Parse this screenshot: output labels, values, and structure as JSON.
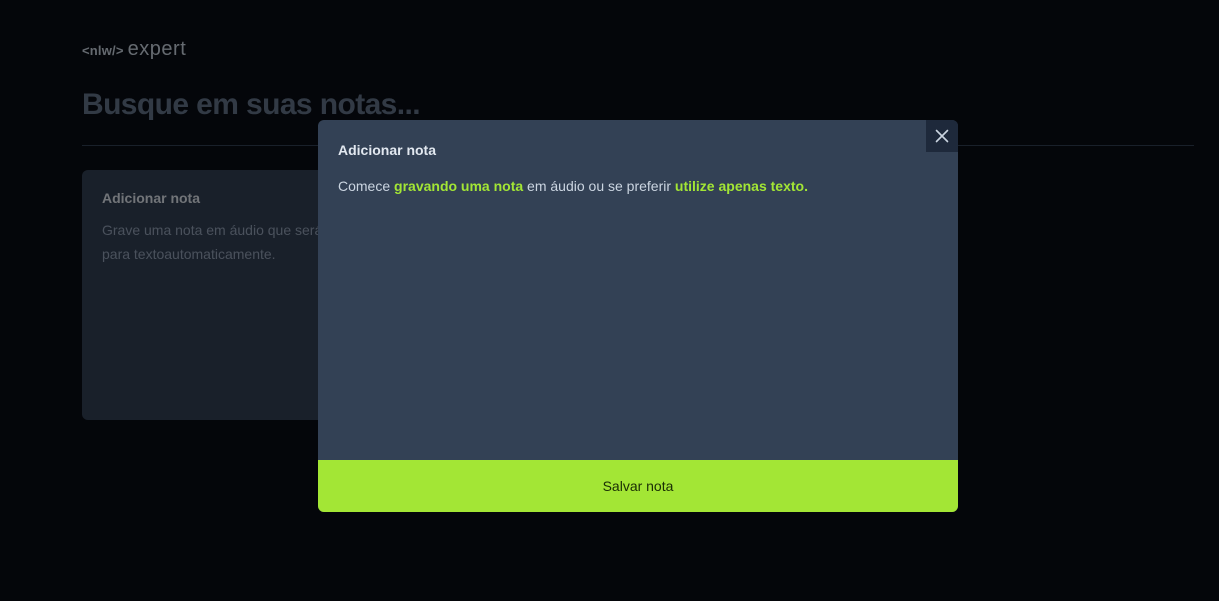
{
  "brand": {
    "logo_tag": "<nlw/>",
    "logo_word": "expert"
  },
  "search": {
    "placeholder": "Busque em suas notas..."
  },
  "add_card": {
    "title": "Adicionar nota",
    "description": "Grave uma nota em áudio que será convertida para textoautomaticamente."
  },
  "modal": {
    "title": "Adicionar nota",
    "text_before": "Comece ",
    "link_record": "gravando uma nota",
    "text_middle": " em áudio ou se preferir ",
    "link_text": "utilize apenas texto.",
    "save_label": "Salvar nota",
    "close_icon": "close-icon"
  },
  "colors": {
    "background": "#080c14",
    "card": "#334155",
    "accent": "#a3e635"
  }
}
